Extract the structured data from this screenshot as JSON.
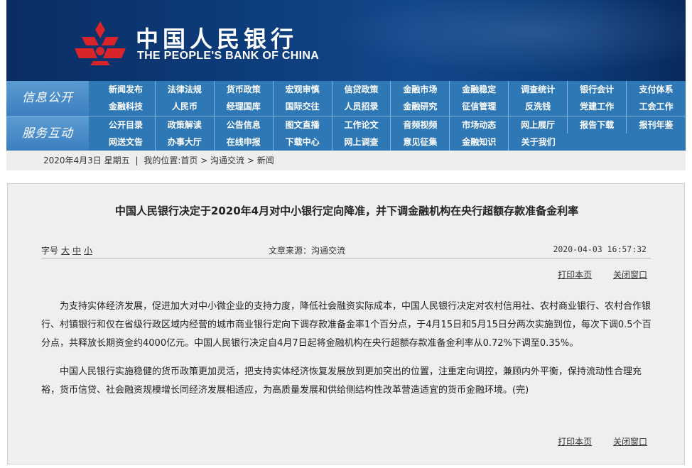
{
  "header": {
    "brand_cn": "中国人民银行",
    "brand_en": "THE PEOPLE'S BANK OF CHINA",
    "emblem_color": "#d8242a",
    "bg_color": "#0c3a78"
  },
  "nav": {
    "section1_label": "信息公开",
    "section1_rows": [
      [
        "新闻发布",
        "法律法规",
        "货币政策",
        "宏观审慎",
        "信贷政策",
        "金融市场",
        "金融稳定",
        "调查统计",
        "银行会计",
        "支付体系"
      ],
      [
        "金融科技",
        "人民币",
        "经理国库",
        "国际交往",
        "人员招录",
        "金融研究",
        "征信管理",
        "反洗钱",
        "党建工作",
        "工会工作"
      ]
    ],
    "section2_label": "服务互动",
    "section2_rows": [
      [
        "公开目录",
        "政策解读",
        "公告信息",
        "图文直播",
        "工作论文",
        "音频视频",
        "市场动态",
        "网上展厅",
        "报告下载",
        "报刊年鉴"
      ],
      [
        "网送文告",
        "办事大厅",
        "在线申报",
        "下载中心",
        "网上调查",
        "意见征集",
        "金融知识",
        "关于我们"
      ]
    ],
    "color": "#2f78b6"
  },
  "breadcrumb": {
    "date": "2020年4月3日 星期五",
    "separator": "|",
    "location": "我的位置:首页 > 沟通交流 > 新闻"
  },
  "article": {
    "title": "中国人民银行决定于2020年4月对中小银行定向降准，并下调金融机构在央行超额存款准备金利率",
    "font_label": "字号",
    "font_sizes": [
      "大",
      "中",
      "小"
    ],
    "source": "文章来源：沟通交流",
    "datetime": "2020-04-03 16:57:32",
    "print_label": "打印本页",
    "close_label": "关闭窗口",
    "paragraphs": [
      "为支持实体经济发展，促进加大对中小微企业的支持力度，降低社会融资实际成本，中国人民银行决定对农村信用社、农村商业银行、农村合作银行、村镇银行和仅在省级行政区域内经营的城市商业银行定向下调存款准备金率1个百分点，于4月15日和5月15日分两次实施到位，每次下调0.5个百分点，共释放长期资金约4000亿元。中国人民银行决定自4月7日起将金融机构在央行超额存款准备金利率从0.72%下调至0.35%。",
      "中国人民银行实施稳健的货币政策更加灵活，把支持实体经济恢复发展放到更加突出的位置，注重定向调控，兼顾内外平衡，保持流动性合理充裕，货币信贷、社会融资规模增长同经济发展相适应，为高质量发展和供给侧结构性改革营造适宜的货币金融环境。(完)"
    ]
  }
}
